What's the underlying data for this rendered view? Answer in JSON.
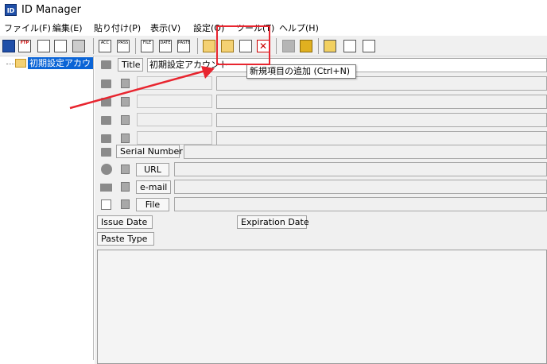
{
  "window": {
    "title": "ID Manager",
    "app_icon_text": "ID"
  },
  "menu": {
    "items": [
      "ファイル(F)",
      "編集(E)",
      "貼り付け(P)",
      "表示(V)",
      "設定(O)",
      "ツール(T)",
      "ヘルプ(H)"
    ]
  },
  "toolbar": {
    "buttons": [
      "save-icon",
      "ftp-icon",
      "url-icon",
      "url2-icon",
      "key-icon",
      "acc-icon",
      "pass-icon",
      "file-icon",
      "date-icon",
      "paste-icon",
      "folder-new-icon",
      "folder-add-icon",
      "new-item-icon",
      "delete-icon",
      "gray-icon",
      "gear-icon",
      "lock-icon",
      "window-icon",
      "pass-check-icon"
    ],
    "acc_text": "ACC",
    "pass_text": "PASS",
    "file_text": "FILE",
    "date_text": "DATE",
    "paste_text": "PASTE",
    "ftp_text": "FTP"
  },
  "tree": {
    "root_label": "初期設定アカウ"
  },
  "tooltip": {
    "text": "新規項目の追加 (Ctrl+N)"
  },
  "fields": {
    "title_label": "Title",
    "title_value": "初期設定アカウント",
    "serial_label": "Serial Number",
    "url_label": "URL",
    "email_label": "e-mail",
    "file_label": "File",
    "issue_date_label": "Issue Date",
    "expiration_date_label": "Expiration Date",
    "paste_type_label": "Paste Type"
  },
  "annotation": {
    "highlight_color": "#e8252f"
  }
}
